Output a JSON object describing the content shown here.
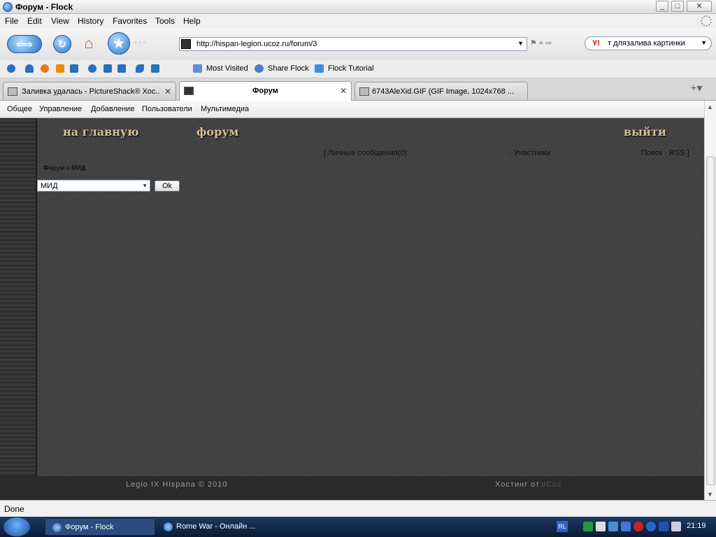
{
  "window": {
    "title": "Форум - Flock"
  },
  "menu": [
    "File",
    "Edit",
    "View",
    "History",
    "Favorites",
    "Tools",
    "Help"
  ],
  "address": {
    "url": "http://hispan-legion.ucoz.ru/forum/3"
  },
  "search": {
    "value": "т длязалива картинки",
    "engine_mark": "Y!"
  },
  "bookmarks": [
    "Most Visited",
    "Share Flock",
    "Flock Tutorial"
  ],
  "tabs": [
    {
      "title": "Заливка удалась - PictureShack® Хос..."
    },
    {
      "title": "Форум"
    },
    {
      "title": "6743AleXid.GIF (GIF Image, 1024x768 ..."
    }
  ],
  "ucoz_bar": [
    "Общее",
    "Управление",
    "Добавление",
    "Пользователи",
    "Мультимедиа"
  ],
  "site": {
    "nav": {
      "home": "на главную",
      "forum": "форум",
      "logout": "выйти"
    },
    "links": {
      "pm": "[ Личные сообщения(0)",
      "members": "· Участники",
      "search_rss": "· Поиск · RSS ]"
    },
    "breadcrumb": "Форум » МИД",
    "select_value": "МИД",
    "ok_label": "Ok",
    "footer_left": "Legio IX Hispana © 2010",
    "footer_right": "Хостинг от",
    "footer_brand": "uCoz"
  },
  "status": {
    "text": "Done"
  },
  "taskbar": {
    "items": [
      "Форум - Flock",
      "Rome War - Онлайн ..."
    ],
    "lang": "RL",
    "clock": "21:19"
  }
}
